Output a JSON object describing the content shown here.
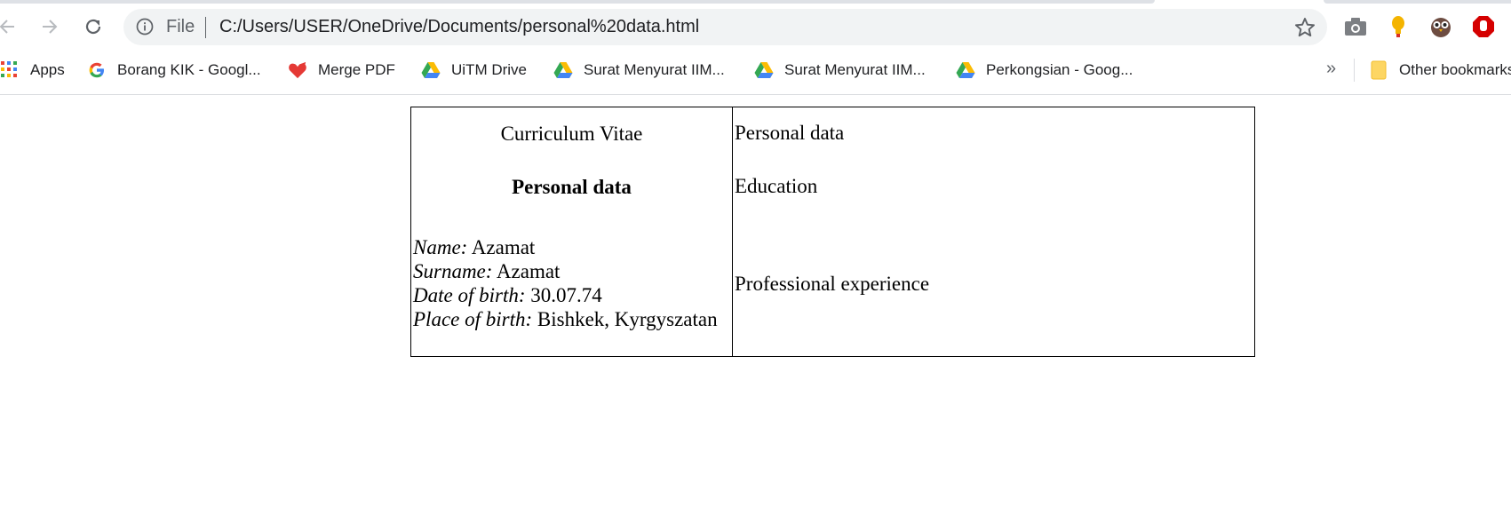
{
  "browser": {
    "omnibox": {
      "scheme_label": "File",
      "url": "C:/Users/USER/OneDrive/Documents/personal%20data.html"
    },
    "bookmarks": [
      {
        "label": "Apps",
        "icon": "apps-grid-icon"
      },
      {
        "label": "Borang KIK - Googl...",
        "icon": "google-g-icon"
      },
      {
        "label": "Merge PDF",
        "icon": "heart-pdf-icon"
      },
      {
        "label": "UiTM Drive",
        "icon": "google-drive-icon"
      },
      {
        "label": "Surat Menyurat IIM...",
        "icon": "google-drive-icon"
      },
      {
        "label": "Surat Menyurat IIM...",
        "icon": "google-drive-icon"
      },
      {
        "label": "Perkongsian - Goog...",
        "icon": "google-drive-icon"
      }
    ],
    "more_bookmarks": "»",
    "other_bookmarks": "Other bookmarks"
  },
  "cv": {
    "title": "Curriculum Vitae",
    "subtitle": "Personal data",
    "fields": [
      {
        "label": "Name:",
        "value": " Azamat"
      },
      {
        "label": "Surname:",
        "value": " Azamat"
      },
      {
        "label": "Date of birth:",
        "value": " 30.07.74"
      },
      {
        "label": "Place of birth:",
        "value": " Bishkek, Kyrgyszatan"
      }
    ],
    "sections": [
      "Personal data",
      "Education",
      "Professional experience"
    ]
  }
}
